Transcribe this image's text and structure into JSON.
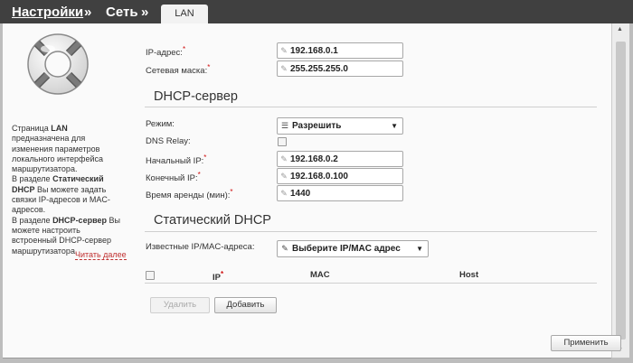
{
  "breadcrumb": {
    "level1": "Настройки",
    "sep1": "»",
    "level2": "Сеть",
    "sep2": "»",
    "tab": "LAN"
  },
  "sidebar": {
    "description_lines": [
      "Страница LAN",
      "предназначена для",
      "изменения параметров",
      "локального интерфейса",
      "маршрутизатора.",
      "В разделе Статический",
      "DHCP Вы можете задать",
      "связки IP-адресов и MAC-",
      "адресов.",
      "В разделе DHCP-сервер Вы",
      "можете настроить",
      "встроенный DHCP-сервер",
      "маршрутизатора."
    ],
    "read_more": "Читать далее"
  },
  "lan": {
    "ip_label": "IP-адрес:",
    "ip_value": "192.168.0.1",
    "mask_label": "Сетевая маска:",
    "mask_value": "255.255.255.0"
  },
  "dhcp": {
    "title": "DHCP-сервер",
    "mode_label": "Режим:",
    "mode_value": "Разрешить",
    "dns_relay_label": "DNS Relay:",
    "start_ip_label": "Начальный IP:",
    "start_ip_value": "192.168.0.2",
    "end_ip_label": "Конечный IP:",
    "end_ip_value": "192.168.0.100",
    "lease_label": "Время аренды (мин):",
    "lease_value": "1440"
  },
  "static_dhcp": {
    "title": "Статический DHCP",
    "known_label": "Известные IP/MAC-адреса:",
    "known_select": "Выберите IP/MAC адрес",
    "columns": [
      "IP",
      "MAC",
      "Host"
    ],
    "delete_label": "Удалить",
    "add_label": "Добавить"
  },
  "apply_label": "Применить",
  "required_mark": "*"
}
